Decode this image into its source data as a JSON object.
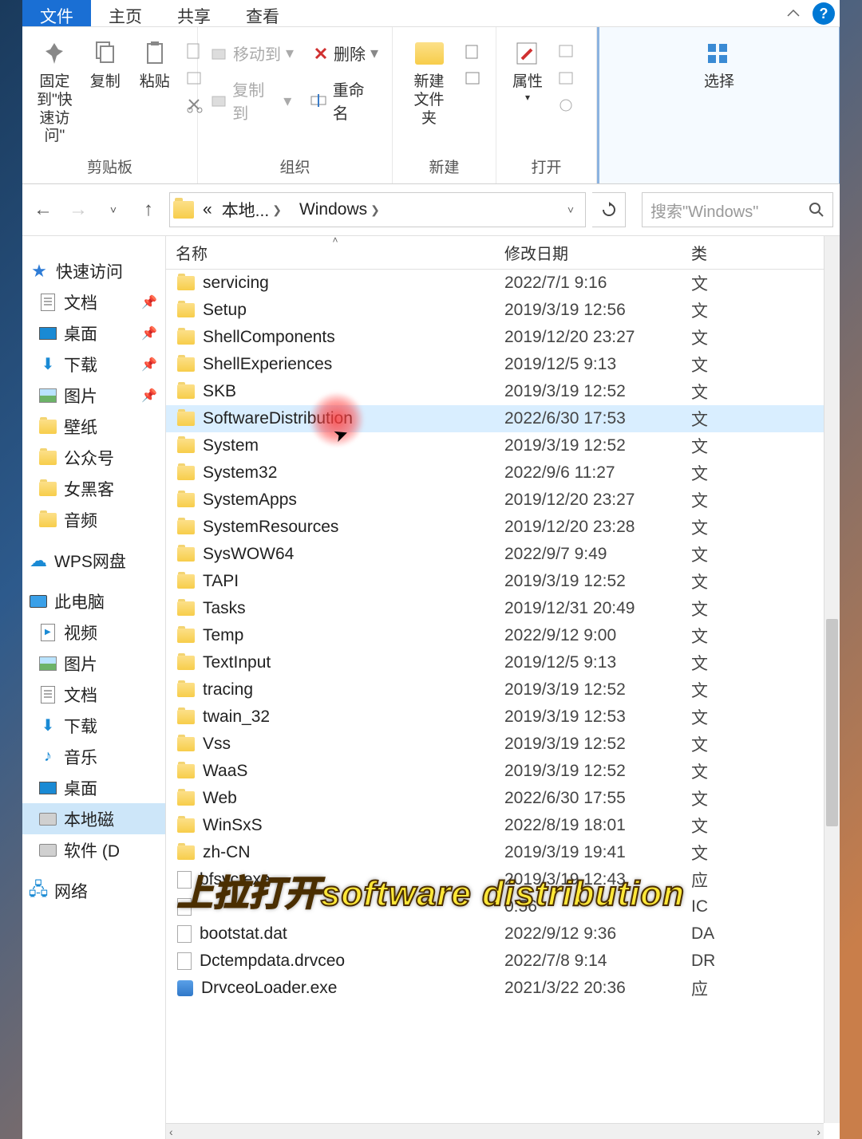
{
  "tabs": {
    "file": "文件",
    "home": "主页",
    "share": "共享",
    "view": "查看"
  },
  "ribbon": {
    "clipboard": {
      "pin": "固定到\"快\n速访问\"",
      "copy": "复制",
      "paste": "粘贴",
      "label": "剪贴板"
    },
    "organize": {
      "moveTo": "移动到",
      "copyTo": "复制到",
      "delete": "删除",
      "rename": "重命名",
      "label": "组织"
    },
    "new": {
      "newFolder": "新建\n文件夹",
      "label": "新建"
    },
    "open": {
      "props": "属性",
      "label": "打开"
    },
    "select": {
      "select": "选择",
      "label": ""
    }
  },
  "breadcrumb": {
    "ellipsis": "«",
    "local": "本地...",
    "windows": "Windows"
  },
  "search": {
    "placeholder": "搜索\"Windows\""
  },
  "headers": {
    "name": "名称",
    "date": "修改日期",
    "type": "类"
  },
  "sidebar": {
    "quick": "快速访问",
    "quickItems": [
      {
        "label": "文档",
        "icon": "doc",
        "pin": true
      },
      {
        "label": "桌面",
        "icon": "desktop",
        "pin": true
      },
      {
        "label": "下载",
        "icon": "download",
        "pin": true
      },
      {
        "label": "图片",
        "icon": "pic",
        "pin": true
      },
      {
        "label": "壁纸",
        "icon": "folder",
        "pin": false
      },
      {
        "label": "公众号",
        "icon": "folder",
        "pin": false
      },
      {
        "label": "女黑客",
        "icon": "folder",
        "pin": false
      },
      {
        "label": "音频",
        "icon": "folder",
        "pin": false
      }
    ],
    "wps": "WPS网盘",
    "pc": "此电脑",
    "pcItems": [
      {
        "label": "视频",
        "icon": "video"
      },
      {
        "label": "图片",
        "icon": "pic"
      },
      {
        "label": "文档",
        "icon": "doc"
      },
      {
        "label": "下载",
        "icon": "download"
      },
      {
        "label": "音乐",
        "icon": "music"
      },
      {
        "label": "桌面",
        "icon": "desktop"
      },
      {
        "label": "本地磁",
        "icon": "disk",
        "selected": true
      },
      {
        "label": "软件 (D",
        "icon": "disk"
      }
    ],
    "network": "网络"
  },
  "files": [
    {
      "name": "servicing",
      "date": "2022/7/1 9:16",
      "type": "文",
      "kind": "folder"
    },
    {
      "name": "Setup",
      "date": "2019/3/19 12:56",
      "type": "文",
      "kind": "folder"
    },
    {
      "name": "ShellComponents",
      "date": "2019/12/20 23:27",
      "type": "文",
      "kind": "folder"
    },
    {
      "name": "ShellExperiences",
      "date": "2019/12/5 9:13",
      "type": "文",
      "kind": "folder"
    },
    {
      "name": "SKB",
      "date": "2019/3/19 12:52",
      "type": "文",
      "kind": "folder"
    },
    {
      "name": "SoftwareDistribution",
      "date": "2022/6/30 17:53",
      "type": "文",
      "kind": "folder",
      "hover": true
    },
    {
      "name": "System",
      "date": "2019/3/19 12:52",
      "type": "文",
      "kind": "folder"
    },
    {
      "name": "System32",
      "date": "2022/9/6 11:27",
      "type": "文",
      "kind": "folder"
    },
    {
      "name": "SystemApps",
      "date": "2019/12/20 23:27",
      "type": "文",
      "kind": "folder"
    },
    {
      "name": "SystemResources",
      "date": "2019/12/20 23:28",
      "type": "文",
      "kind": "folder"
    },
    {
      "name": "SysWOW64",
      "date": "2022/9/7 9:49",
      "type": "文",
      "kind": "folder"
    },
    {
      "name": "TAPI",
      "date": "2019/3/19 12:52",
      "type": "文",
      "kind": "folder"
    },
    {
      "name": "Tasks",
      "date": "2019/12/31 20:49",
      "type": "文",
      "kind": "folder"
    },
    {
      "name": "Temp",
      "date": "2022/9/12 9:00",
      "type": "文",
      "kind": "folder"
    },
    {
      "name": "TextInput",
      "date": "2019/12/5 9:13",
      "type": "文",
      "kind": "folder"
    },
    {
      "name": "tracing",
      "date": "2019/3/19 12:52",
      "type": "文",
      "kind": "folder"
    },
    {
      "name": "twain_32",
      "date": "2019/3/19 12:53",
      "type": "文",
      "kind": "folder"
    },
    {
      "name": "Vss",
      "date": "2019/3/19 12:52",
      "type": "文",
      "kind": "folder"
    },
    {
      "name": "WaaS",
      "date": "2019/3/19 12:52",
      "type": "文",
      "kind": "folder"
    },
    {
      "name": "Web",
      "date": "2022/6/30 17:55",
      "type": "文",
      "kind": "folder"
    },
    {
      "name": "WinSxS",
      "date": "2022/8/19 18:01",
      "type": "文",
      "kind": "folder"
    },
    {
      "name": "zh-CN",
      "date": "2019/3/19 19:41",
      "type": "文",
      "kind": "folder"
    },
    {
      "name": "bfsvc.exe",
      "date": "2019/3/19 12:43",
      "type": "应",
      "kind": "file"
    },
    {
      "name": "",
      "date": "0:56",
      "type": "IC",
      "kind": "file"
    },
    {
      "name": "bootstat.dat",
      "date": "2022/9/12 9:36",
      "type": "DA",
      "kind": "file"
    },
    {
      "name": "Dctempdata.drvceo",
      "date": "2022/7/8 9:14",
      "type": "DR",
      "kind": "file"
    },
    {
      "name": "DrvceoLoader.exe",
      "date": "2021/3/22 20:36",
      "type": "应",
      "kind": "exe"
    }
  ],
  "caption": "上拉打开software distribution"
}
